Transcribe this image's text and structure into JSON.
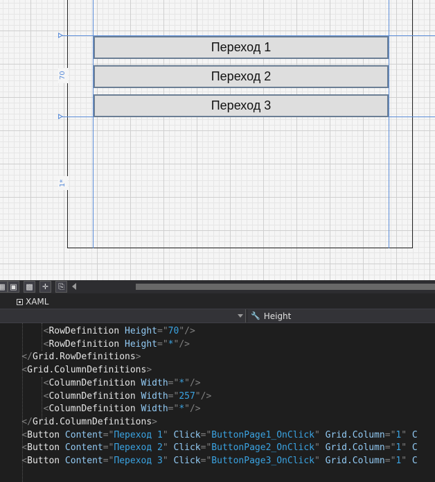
{
  "designer": {
    "buttons": [
      {
        "label": "Переход 1"
      },
      {
        "label": "Переход 2"
      },
      {
        "label": "Переход 3"
      }
    ],
    "row_markers": {
      "row1": "70",
      "row2": "1*"
    }
  },
  "toolbar": {
    "icons": [
      "grid-view-icon",
      "snap-grid-icon",
      "artboard-icon",
      "snap-lines-icon",
      "effects-icon"
    ]
  },
  "tabs": {
    "xaml": "XAML"
  },
  "property_bar": {
    "selected_property": "Height"
  },
  "code": {
    "lines": [
      {
        "indent": "        ",
        "open": "<",
        "tag": "RowDefinition",
        "attr1": "Height",
        "eq1": "=\"",
        "val1": "70",
        "close1": "\"",
        "rest": "/>"
      },
      {
        "indent": "        ",
        "open": "<",
        "tag": "RowDefinition",
        "attr1": "Height",
        "eq1": "=\"",
        "val1": "*",
        "close1": "\"",
        "rest": "/>"
      },
      {
        "indent": "    ",
        "open": "</",
        "tag": "Grid.RowDefinitions",
        "rest": ">"
      },
      {
        "indent": "    ",
        "open": "<",
        "tag": "Grid.ColumnDefinitions",
        "rest": ">"
      },
      {
        "indent": "        ",
        "open": "<",
        "tag": "ColumnDefinition",
        "attr1": "Width",
        "eq1": "=\"",
        "val1": "*",
        "close1": "\"",
        "rest": "/>"
      },
      {
        "indent": "        ",
        "open": "<",
        "tag": "ColumnDefinition",
        "attr1": "Width",
        "eq1": "=\"",
        "val1": "257",
        "close1": "\"",
        "rest": "/>"
      },
      {
        "indent": "        ",
        "open": "<",
        "tag": "ColumnDefinition",
        "attr1": "Width",
        "eq1": "=\"",
        "val1": "*",
        "close1": "\"",
        "rest": "/>"
      },
      {
        "indent": "    ",
        "open": "</",
        "tag": "Grid.ColumnDefinitions",
        "rest": ">"
      },
      {
        "indent": "    ",
        "open": "<",
        "tag": "Button",
        "attr1": "Content",
        "eq1": "=\"",
        "val1": "Переход 1",
        "close1": "\"",
        "attr2": "Click",
        "val2": "ButtonPage1_OnClick",
        "attr3": "Grid.Column",
        "val3": "1",
        "tail": " C"
      },
      {
        "indent": "    ",
        "open": "<",
        "tag": "Button",
        "attr1": "Content",
        "eq1": "=\"",
        "val1": "Переход 2",
        "close1": "\"",
        "attr2": "Click",
        "val2": "ButtonPage2_OnClick",
        "attr3": "Grid.Column",
        "val3": "1",
        "tail": " C"
      },
      {
        "indent": "    ",
        "open": "<",
        "tag": "Button",
        "attr1": "Content",
        "eq1": "=\"",
        "val1": "Переход 3",
        "close1": "\"",
        "attr2": "Click",
        "val2": "ButtonPage3_OnClick",
        "attr3": "Grid.Column",
        "val3": "1",
        "tail": " C"
      }
    ]
  },
  "colors": {
    "guide": "#5b8dd9",
    "code_tag": "#e6e6e6",
    "code_attr": "#92caf4",
    "code_value": "#3aa3e2",
    "code_punct": "#808080",
    "editor_bg": "#1e1e1e"
  }
}
